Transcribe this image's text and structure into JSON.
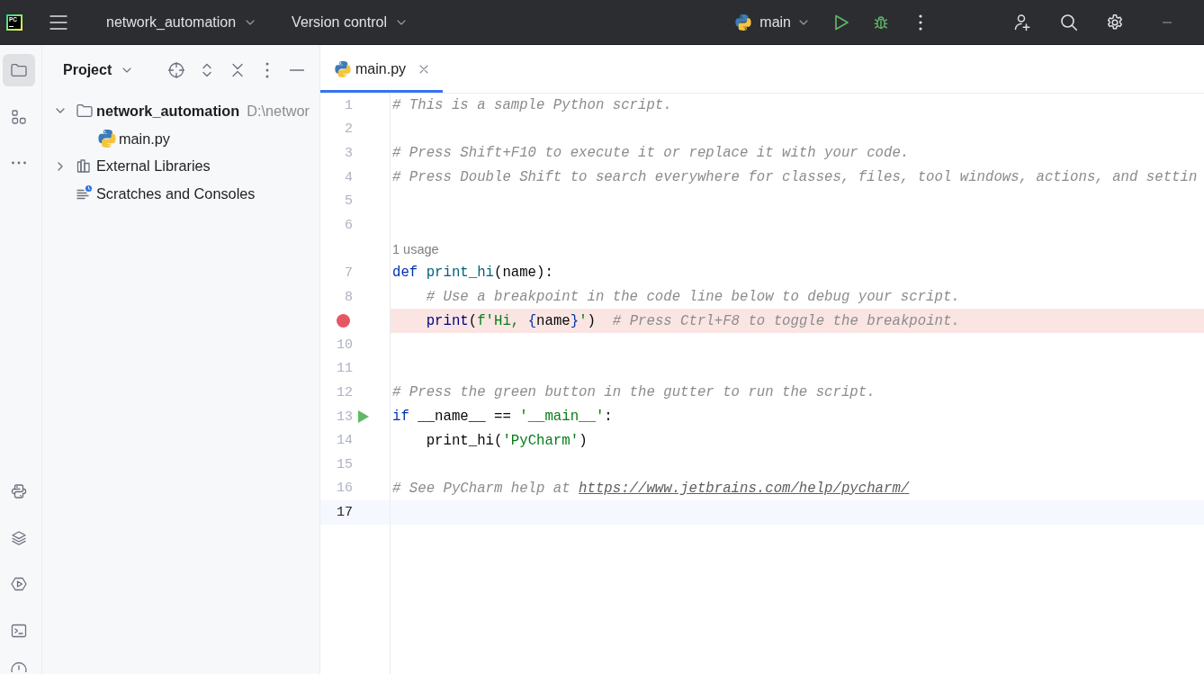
{
  "title_bar": {
    "logo_text": "PC",
    "project": "network_automation",
    "vcs": "Version control",
    "run_config": "main"
  },
  "tool_windows": {
    "top": [
      {
        "kind": "folder",
        "selected": true
      },
      {
        "kind": "structure",
        "selected": false
      },
      {
        "kind": "more",
        "selected": false
      }
    ],
    "bottom": [
      {
        "kind": "python",
        "selected": false
      },
      {
        "kind": "layers",
        "selected": false
      },
      {
        "kind": "run",
        "selected": false
      },
      {
        "kind": "terminal",
        "selected": false
      },
      {
        "kind": "alert",
        "selected": false
      }
    ]
  },
  "project_panel": {
    "title": "Project",
    "tree": [
      {
        "kind": "project",
        "label": "network_automation",
        "path": "D:\\networ",
        "expanded": true,
        "children": [
          {
            "kind": "python",
            "label": "main.py"
          }
        ]
      },
      {
        "kind": "libraries",
        "label": "External Libraries",
        "expanded": false
      },
      {
        "kind": "scratches",
        "label": "Scratches and Consoles"
      }
    ]
  },
  "editor": {
    "tabs": [
      {
        "kind": "python",
        "label": "main.py",
        "selected": true
      }
    ],
    "lines": [
      {
        "kind": "code",
        "number": "1",
        "current": false,
        "breakpoint": false,
        "runnable": false,
        "tokens": [
          {
            "kind": "comment",
            "text": "# This is a sample Python script."
          }
        ]
      },
      {
        "kind": "code",
        "number": "2",
        "current": false,
        "breakpoint": false,
        "runnable": false
      },
      {
        "kind": "code",
        "number": "3",
        "current": false,
        "breakpoint": false,
        "runnable": false,
        "tokens": [
          {
            "kind": "comment",
            "text": "# Press Shift+F10 to execute it or replace it with your code."
          }
        ]
      },
      {
        "kind": "code",
        "number": "4",
        "current": false,
        "breakpoint": false,
        "runnable": false,
        "tokens": [
          {
            "kind": "comment",
            "text": "# Press Double Shift to search everywhere for classes, files, tool windows, actions, and settin"
          }
        ]
      },
      {
        "kind": "code",
        "number": "5",
        "current": false,
        "breakpoint": false,
        "runnable": false
      },
      {
        "kind": "code",
        "number": "6",
        "current": false,
        "breakpoint": false,
        "runnable": false
      },
      {
        "kind": "inlay",
        "text": "1 usage"
      },
      {
        "kind": "code",
        "number": "7",
        "current": false,
        "breakpoint": false,
        "runnable": false,
        "tokens": [
          {
            "kind": "keyword",
            "text": "def "
          },
          {
            "kind": "function",
            "text": "print_hi"
          },
          {
            "kind": "plain",
            "text": "(name):"
          }
        ]
      },
      {
        "kind": "code",
        "number": "8",
        "current": false,
        "breakpoint": false,
        "runnable": false,
        "tokens": [
          {
            "kind": "comment",
            "text": "    # Use a breakpoint in the code line below to debug your script."
          }
        ]
      },
      {
        "kind": "code",
        "current": false,
        "breakpoint": true,
        "runnable": false,
        "tokens": [
          {
            "kind": "builtin",
            "text": "    print"
          },
          {
            "kind": "plain",
            "text": "("
          },
          {
            "kind": "string",
            "text": "f'Hi, "
          },
          {
            "kind": "brace",
            "text": "{"
          },
          {
            "kind": "plain",
            "text": "name"
          },
          {
            "kind": "brace",
            "text": "}"
          },
          {
            "kind": "string",
            "text": "'"
          },
          {
            "kind": "plain",
            "text": ")  "
          },
          {
            "kind": "comment",
            "text": "# Press Ctrl+F8 to toggle the breakpoint."
          }
        ]
      },
      {
        "kind": "code",
        "number": "10",
        "current": false,
        "breakpoint": false,
        "runnable": false
      },
      {
        "kind": "code",
        "number": "11",
        "current": false,
        "breakpoint": false,
        "runnable": false
      },
      {
        "kind": "code",
        "number": "12",
        "current": false,
        "breakpoint": false,
        "runnable": false,
        "tokens": [
          {
            "kind": "comment",
            "text": "# Press the green button in the gutter to run the script."
          }
        ]
      },
      {
        "kind": "code",
        "number": "13",
        "current": false,
        "breakpoint": false,
        "runnable": true,
        "tokens": [
          {
            "kind": "keyword",
            "text": "if"
          },
          {
            "kind": "plain",
            "text": " __name__ == "
          },
          {
            "kind": "string",
            "text": "'__main__'"
          },
          {
            "kind": "plain",
            "text": ":"
          }
        ]
      },
      {
        "kind": "code",
        "number": "14",
        "current": false,
        "breakpoint": false,
        "runnable": false,
        "tokens": [
          {
            "kind": "plain",
            "text": "    print_hi("
          },
          {
            "kind": "string",
            "text": "'PyCharm'"
          },
          {
            "kind": "plain",
            "text": ")"
          }
        ]
      },
      {
        "kind": "code",
        "number": "15",
        "current": false,
        "breakpoint": false,
        "runnable": false
      },
      {
        "kind": "code",
        "number": "16",
        "current": false,
        "breakpoint": false,
        "runnable": false,
        "tokens": [
          {
            "kind": "comment",
            "text": "# See PyCharm help at "
          },
          {
            "kind": "link",
            "text": "https://www.jetbrains.com/help/pycharm/"
          }
        ]
      },
      {
        "kind": "code",
        "number": "17",
        "current": true,
        "breakpoint": false,
        "runnable": false
      }
    ]
  }
}
